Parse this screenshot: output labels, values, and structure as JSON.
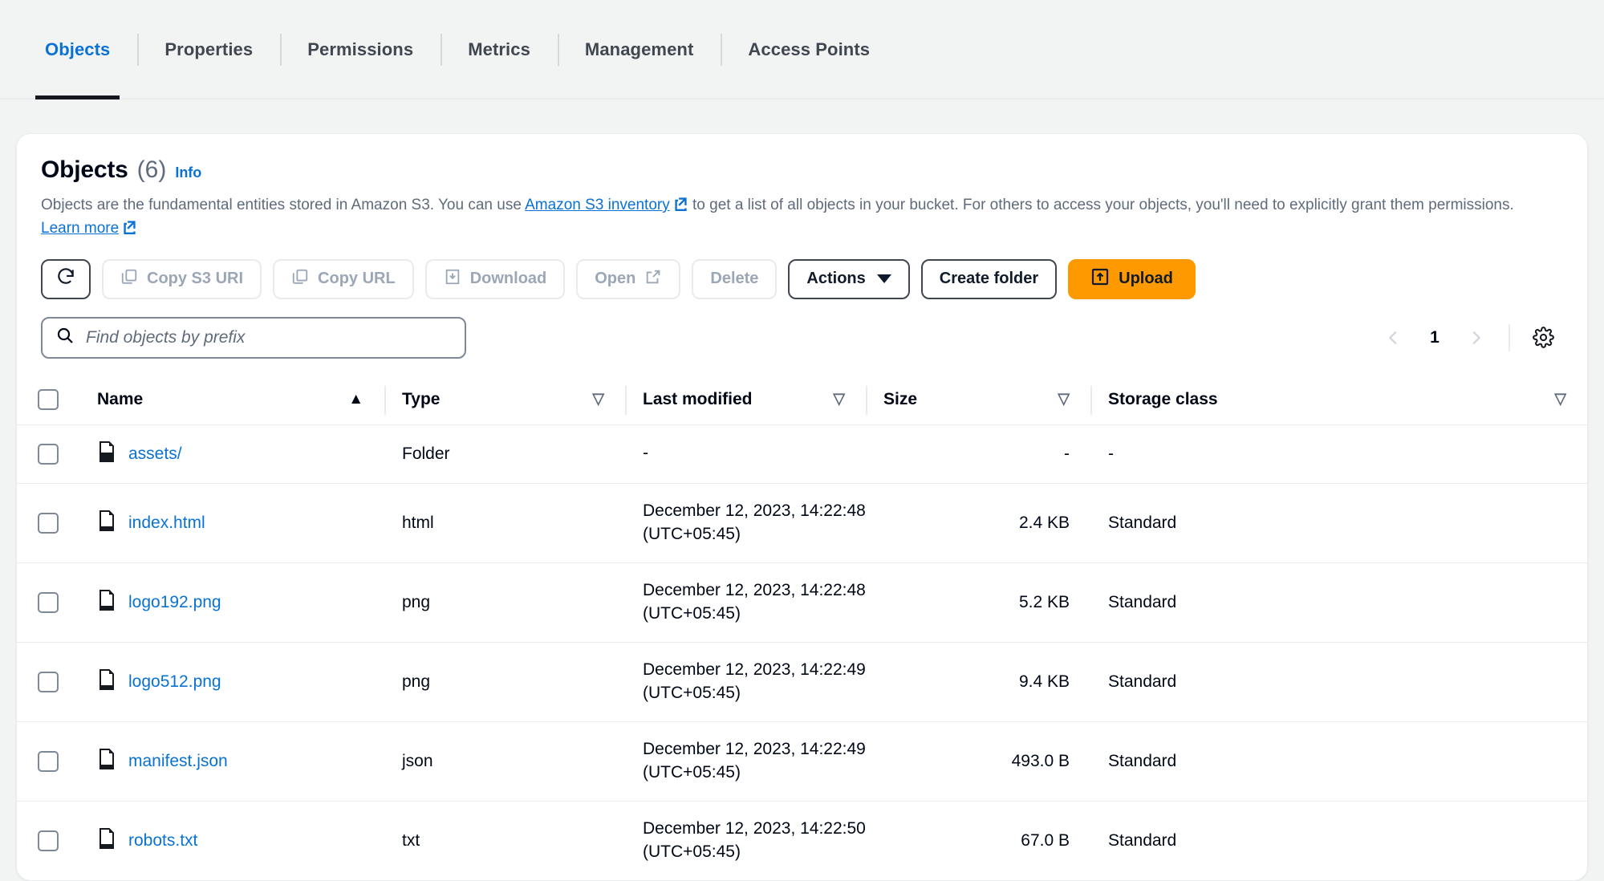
{
  "tabs": [
    {
      "label": "Objects",
      "active": true
    },
    {
      "label": "Properties",
      "active": false
    },
    {
      "label": "Permissions",
      "active": false
    },
    {
      "label": "Metrics",
      "active": false
    },
    {
      "label": "Management",
      "active": false
    },
    {
      "label": "Access Points",
      "active": false
    }
  ],
  "panel": {
    "title": "Objects",
    "count": "(6)",
    "info_label": "Info",
    "description_part1": "Objects are the fundamental entities stored in Amazon S3. You can use ",
    "description_link1": "Amazon S3 inventory",
    "description_part2": " to get a list of all objects in your bucket. For others to access your objects, you'll need to explicitly grant them permissions. ",
    "description_link2": "Learn more"
  },
  "toolbar": {
    "refresh_icon": "refresh-icon",
    "copy_s3_uri": "Copy S3 URI",
    "copy_url": "Copy URL",
    "download": "Download",
    "open": "Open",
    "delete": "Delete",
    "actions": "Actions",
    "create_folder": "Create folder",
    "upload": "Upload"
  },
  "search": {
    "placeholder": "Find objects by prefix",
    "value": ""
  },
  "pagination": {
    "prev": "prev-page",
    "current": "1",
    "next": "next-page",
    "settings": "table-preferences"
  },
  "table": {
    "columns": [
      {
        "label": "Name",
        "sort": "▲",
        "sort_active": true
      },
      {
        "label": "Type",
        "sort": "▽",
        "sort_active": false
      },
      {
        "label": "Last modified",
        "sort": "▽",
        "sort_active": false
      },
      {
        "label": "Size",
        "sort": "▽",
        "sort_active": false
      },
      {
        "label": "Storage class",
        "sort": "▽",
        "sort_active": false
      }
    ],
    "rows": [
      {
        "name": "assets/",
        "icon": "folder-icon",
        "type": "Folder",
        "last_modified": "-",
        "last_modified_tz": "",
        "size": "-",
        "storage_class": "-"
      },
      {
        "name": "index.html",
        "icon": "file-icon",
        "type": "html",
        "last_modified": "December 12, 2023, 14:22:48",
        "last_modified_tz": "(UTC+05:45)",
        "size": "2.4 KB",
        "storage_class": "Standard"
      },
      {
        "name": "logo192.png",
        "icon": "file-icon",
        "type": "png",
        "last_modified": "December 12, 2023, 14:22:48",
        "last_modified_tz": "(UTC+05:45)",
        "size": "5.2 KB",
        "storage_class": "Standard"
      },
      {
        "name": "logo512.png",
        "icon": "file-icon",
        "type": "png",
        "last_modified": "December 12, 2023, 14:22:49",
        "last_modified_tz": "(UTC+05:45)",
        "size": "9.4 KB",
        "storage_class": "Standard"
      },
      {
        "name": "manifest.json",
        "icon": "file-icon",
        "type": "json",
        "last_modified": "December 12, 2023, 14:22:49",
        "last_modified_tz": "(UTC+05:45)",
        "size": "493.0 B",
        "storage_class": "Standard"
      },
      {
        "name": "robots.txt",
        "icon": "file-icon",
        "type": "txt",
        "last_modified": "December 12, 2023, 14:22:50",
        "last_modified_tz": "(UTC+05:45)",
        "size": "67.0 B",
        "storage_class": "Standard"
      }
    ]
  },
  "colors": {
    "link": "#0972d3",
    "upload_button": "#ff9900",
    "active_tab_underline": "#16191f",
    "text": "#000716",
    "muted": "#5f6b7a"
  }
}
